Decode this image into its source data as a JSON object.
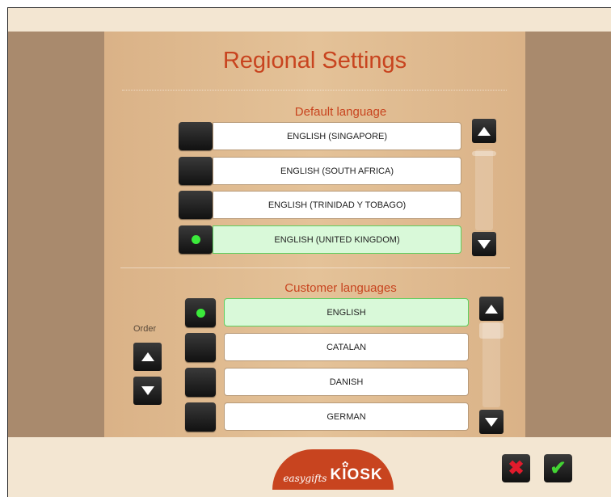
{
  "title": "Regional Settings",
  "default_language": {
    "heading": "Default language",
    "items": [
      {
        "label": "ENGLISH (SINGAPORE)",
        "selected": false
      },
      {
        "label": "ENGLISH (SOUTH AFRICA)",
        "selected": false
      },
      {
        "label": "ENGLISH (TRINIDAD Y TOBAGO)",
        "selected": false
      },
      {
        "label": "ENGLISH (UNITED KINGDOM)",
        "selected": true
      }
    ]
  },
  "customer_languages": {
    "heading": "Customer languages",
    "order_label": "Order",
    "items": [
      {
        "label": "ENGLISH",
        "selected": true
      },
      {
        "label": "CATALAN",
        "selected": false
      },
      {
        "label": "DANISH",
        "selected": false
      },
      {
        "label": "GERMAN",
        "selected": false
      }
    ]
  },
  "logo": {
    "prefix": "easygifts",
    "brand": "KIOSK"
  },
  "icons": {
    "scroll_up": "triangle-up-icon",
    "scroll_down": "triangle-down-icon",
    "cancel": "x-mark-icon",
    "confirm": "check-mark-icon"
  },
  "colors": {
    "accent_red": "#c8441f",
    "selected_row": "#d9f9d9",
    "selected_dot": "#3bea3b",
    "cancel_icon": "#e21b2c",
    "confirm_icon": "#43d433"
  }
}
